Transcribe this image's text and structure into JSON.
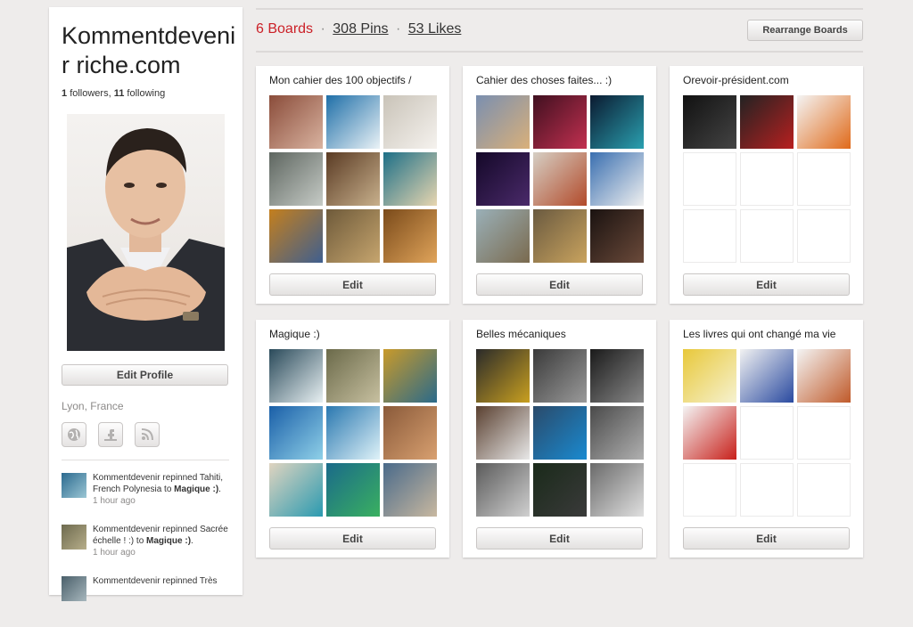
{
  "profile": {
    "name": "Kommentdevenir riche.com",
    "followers_count": "1",
    "followers_label": "followers,",
    "following_count": "11",
    "following_label": "following",
    "edit_profile_label": "Edit Profile",
    "location": "Lyon, France",
    "social": [
      {
        "icon": "globe-icon",
        "glyph": "◍"
      },
      {
        "icon": "facebook-icon",
        "glyph": "f"
      },
      {
        "icon": "rss-icon",
        "glyph": "⦿"
      }
    ]
  },
  "activity": [
    {
      "prefix": "Kommentdevenir repinned Tahiti, French Polynesia to ",
      "board": "Magique :)",
      "suffix": ".",
      "time": "1 hour ago",
      "thumb": [
        "#2b6a8f",
        "#9bc6d4"
      ]
    },
    {
      "prefix": "Kommentdevenir repinned Sacrée échelle ! :) to ",
      "board": "Magique :)",
      "suffix": ".",
      "time": "1 hour ago",
      "thumb": [
        "#6d6a4e",
        "#b7ae8a"
      ]
    },
    {
      "prefix": "Kommentdevenir repinned Très",
      "board": "",
      "suffix": "",
      "time": "",
      "thumb": [
        "#4a5f6a",
        "#a7b7bd"
      ]
    }
  ],
  "header": {
    "boards": "6 Boards",
    "pins": "308 Pins",
    "likes": "53 Likes",
    "separator": "·",
    "rearrange_label": "Rearrange Boards"
  },
  "boards": [
    {
      "title": "Mon cahier des 100 objectifs /",
      "edit_label": "Edit",
      "tiles": [
        [
          "#8a4c3a",
          "#d9b3a0"
        ],
        [
          "#1f6fa8",
          "#eaf2f6"
        ],
        [
          "#c9c3b8",
          "#f5f2ee"
        ],
        [
          "#5e6660",
          "#c6cbc6"
        ],
        [
          "#5a3b24",
          "#c8b08c"
        ],
        [
          "#1d6f87",
          "#e8d6b0"
        ],
        [
          "#c47f1d",
          "#3f5f8f"
        ],
        [
          "#6e5a3a",
          "#c6a56e"
        ],
        [
          "#7a4a1a",
          "#e0a45a"
        ]
      ]
    },
    {
      "title": "Cahier des choses faites... :)",
      "edit_label": "Edit",
      "tiles": [
        [
          "#7a8fb0",
          "#d9b07a"
        ],
        [
          "#401020",
          "#c23050"
        ],
        [
          "#0b1a30",
          "#2aa0b0"
        ],
        [
          "#140828",
          "#4a2a6a"
        ],
        [
          "#d6cfc4",
          "#b24a2a"
        ],
        [
          "#3a6fb0",
          "#f0f0f0"
        ],
        [
          "#9ab0b8",
          "#7a6a4e"
        ],
        [
          "#6a5a40",
          "#c9a35e"
        ],
        [
          "#1a1210",
          "#6b4a3a"
        ]
      ]
    },
    {
      "title": "Orevoir-président.com",
      "edit_label": "Edit",
      "tiles": [
        [
          "#111111",
          "#444444"
        ],
        [
          "#222222",
          "#b82020"
        ],
        [
          "#f4f4f4",
          "#e06a1a"
        ],
        null,
        null,
        null,
        null,
        null,
        null
      ]
    },
    {
      "title": "Magique :)",
      "edit_label": "Edit",
      "tiles": [
        [
          "#2a4a5a",
          "#e8f0f2"
        ],
        [
          "#6b6a4a",
          "#c7c0a0"
        ],
        [
          "#c99a2a",
          "#2a6a8a"
        ],
        [
          "#1a5fa8",
          "#8fd0e8"
        ],
        [
          "#2a78b0",
          "#dff2f8"
        ],
        [
          "#8a5a3a",
          "#d8a070"
        ],
        [
          "#e0d4c0",
          "#2a9ab0"
        ],
        [
          "#1a6a8a",
          "#3ab060"
        ],
        [
          "#4a6a8a",
          "#c8b8a0"
        ]
      ]
    },
    {
      "title": "Belles mécaniques",
      "edit_label": "Edit",
      "tiles": [
        [
          "#2a2a2a",
          "#c9a020"
        ],
        [
          "#3a3a3a",
          "#9a9a9a"
        ],
        [
          "#1a1a1a",
          "#8a8a8a"
        ],
        [
          "#5a4030",
          "#e8e8e8"
        ],
        [
          "#2a4a6a",
          "#1a8ad0"
        ],
        [
          "#4a4a4a",
          "#b0b0b0"
        ],
        [
          "#5a5a5a",
          "#d0d0d0"
        ],
        [
          "#1a2a1a",
          "#3a3a3a"
        ],
        [
          "#6a6a6a",
          "#e0e0e0"
        ]
      ]
    },
    {
      "title": "Les livres qui ont changé ma vie",
      "edit_label": "Edit",
      "tiles": [
        [
          "#e8c83a",
          "#f6f2d0"
        ],
        [
          "#f2f2f2",
          "#2a4aa0"
        ],
        [
          "#f4f4f4",
          "#c05a2a"
        ],
        [
          "#f4f4f4",
          "#c8201a"
        ],
        null,
        null,
        null,
        null,
        null
      ]
    }
  ]
}
